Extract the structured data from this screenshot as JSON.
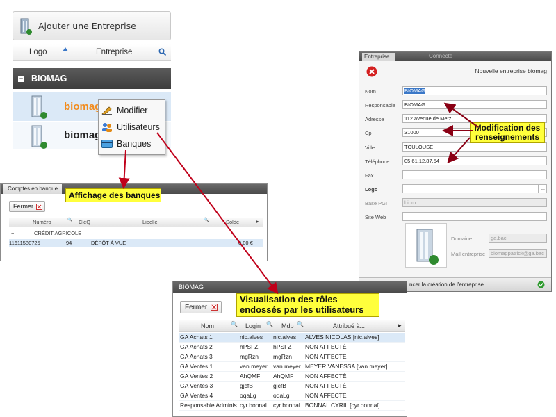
{
  "companies_panel": {
    "add_button_label": "Ajouter une Entreprise",
    "col_logo": "Logo",
    "col_company": "Entreprise",
    "group_name": "BIOMAG",
    "group_toggle": "−",
    "rows": [
      {
        "name": "biomagpatrick"
      },
      {
        "name": "biomagp"
      }
    ],
    "context_menu": {
      "items": [
        {
          "label": "Modifier",
          "icon": "pencil-icon"
        },
        {
          "label": "Utilisateurs",
          "icon": "users-icon"
        },
        {
          "label": "Banques",
          "icon": "card-icon"
        }
      ]
    }
  },
  "bank_panel": {
    "tab_title": "Comptes en banque",
    "close_label": "Fermer",
    "columns": [
      "Numéro",
      "CléQ",
      "Libellé",
      "Solde"
    ],
    "group_toggle": "−",
    "group": "CRÉDIT AGRICOLE",
    "row": {
      "number": "11611580725",
      "key": "94",
      "label": "DÉPÔT À VUE",
      "balance": "0,00 €"
    }
  },
  "company_form": {
    "top_tab": "Entreprise",
    "top_tab_right": "Connecté",
    "title": "Nouvelle entreprise biomag",
    "fields": [
      {
        "label": "Nom",
        "value": "BIOMAG",
        "selected": true
      },
      {
        "label": "Responsable",
        "value": "BIOMAG"
      },
      {
        "label": "Adresse",
        "value": "112 avenue de Metz"
      },
      {
        "label": "Cp",
        "value": "31000"
      },
      {
        "label": "Ville",
        "value": "TOULOUSE"
      },
      {
        "label": "Téléphone",
        "value": "05.61.12.87.54"
      },
      {
        "label": "Fax",
        "value": ""
      },
      {
        "label": "Logo",
        "value": ""
      },
      {
        "label": "Base PGI",
        "value": "biom",
        "disabled": true
      },
      {
        "label": "Site Web",
        "value": ""
      }
    ],
    "logo_browse": "...",
    "domain_label": "Domaine",
    "domain_value": "ga.bac",
    "mail_label": "Mail entreprise",
    "mail_value": "biomagpatrick@ga.bac",
    "footer_label": "ncer la création de l'entreprise"
  },
  "roles_panel": {
    "title": "BIOMAG",
    "close_label": "Fermer",
    "columns": [
      "Nom",
      "Login",
      "Mdp",
      "Attribué à..."
    ],
    "rows": [
      {
        "nom": "GA Achats 1",
        "login": "nic.alves",
        "mdp": "nic.alves",
        "attr": "ALVES NICOLAS [nic.alves]"
      },
      {
        "nom": "GA Achats 2",
        "login": "hPSFZ",
        "mdp": "hPSFZ",
        "attr": "NON AFFECTÉ"
      },
      {
        "nom": "GA Achats 3",
        "login": "mgRzn",
        "mdp": "mgRzn",
        "attr": "NON AFFECTÉ"
      },
      {
        "nom": "GA Ventes 1",
        "login": "van.meyer",
        "mdp": "van.meyer",
        "attr": "MEYER VANESSA [van.meyer]"
      },
      {
        "nom": "GA Ventes 2",
        "login": "AhQMF",
        "mdp": "AhQMF",
        "attr": "NON AFFECTÉ"
      },
      {
        "nom": "GA Ventes 3",
        "login": "gjcfB",
        "mdp": "gjcfB",
        "attr": "NON AFFECTÉ"
      },
      {
        "nom": "GA Ventes 4",
        "login": "oqaLg",
        "mdp": "oqaLg",
        "attr": "NON AFFECTÉ"
      },
      {
        "nom": "Responsable Administ",
        "login": "cyr.bonnal",
        "mdp": "cyr.bonnal",
        "attr": "BONNAL CYRIL [cyr.bonnal]"
      }
    ]
  },
  "annotations": {
    "banques": "Affichage des banques",
    "modif_line1": "Modification des",
    "modif_line2": "renseignements",
    "roles_line1": "Visualisation des rôles",
    "roles_line2": "endossés par les utilisateurs"
  },
  "colors": {
    "accent_orange": "#f28c1e",
    "highlight_yellow": "#ffff3c",
    "arrow_red": "#c0001a",
    "selection_blue": "#dbe9f7"
  }
}
